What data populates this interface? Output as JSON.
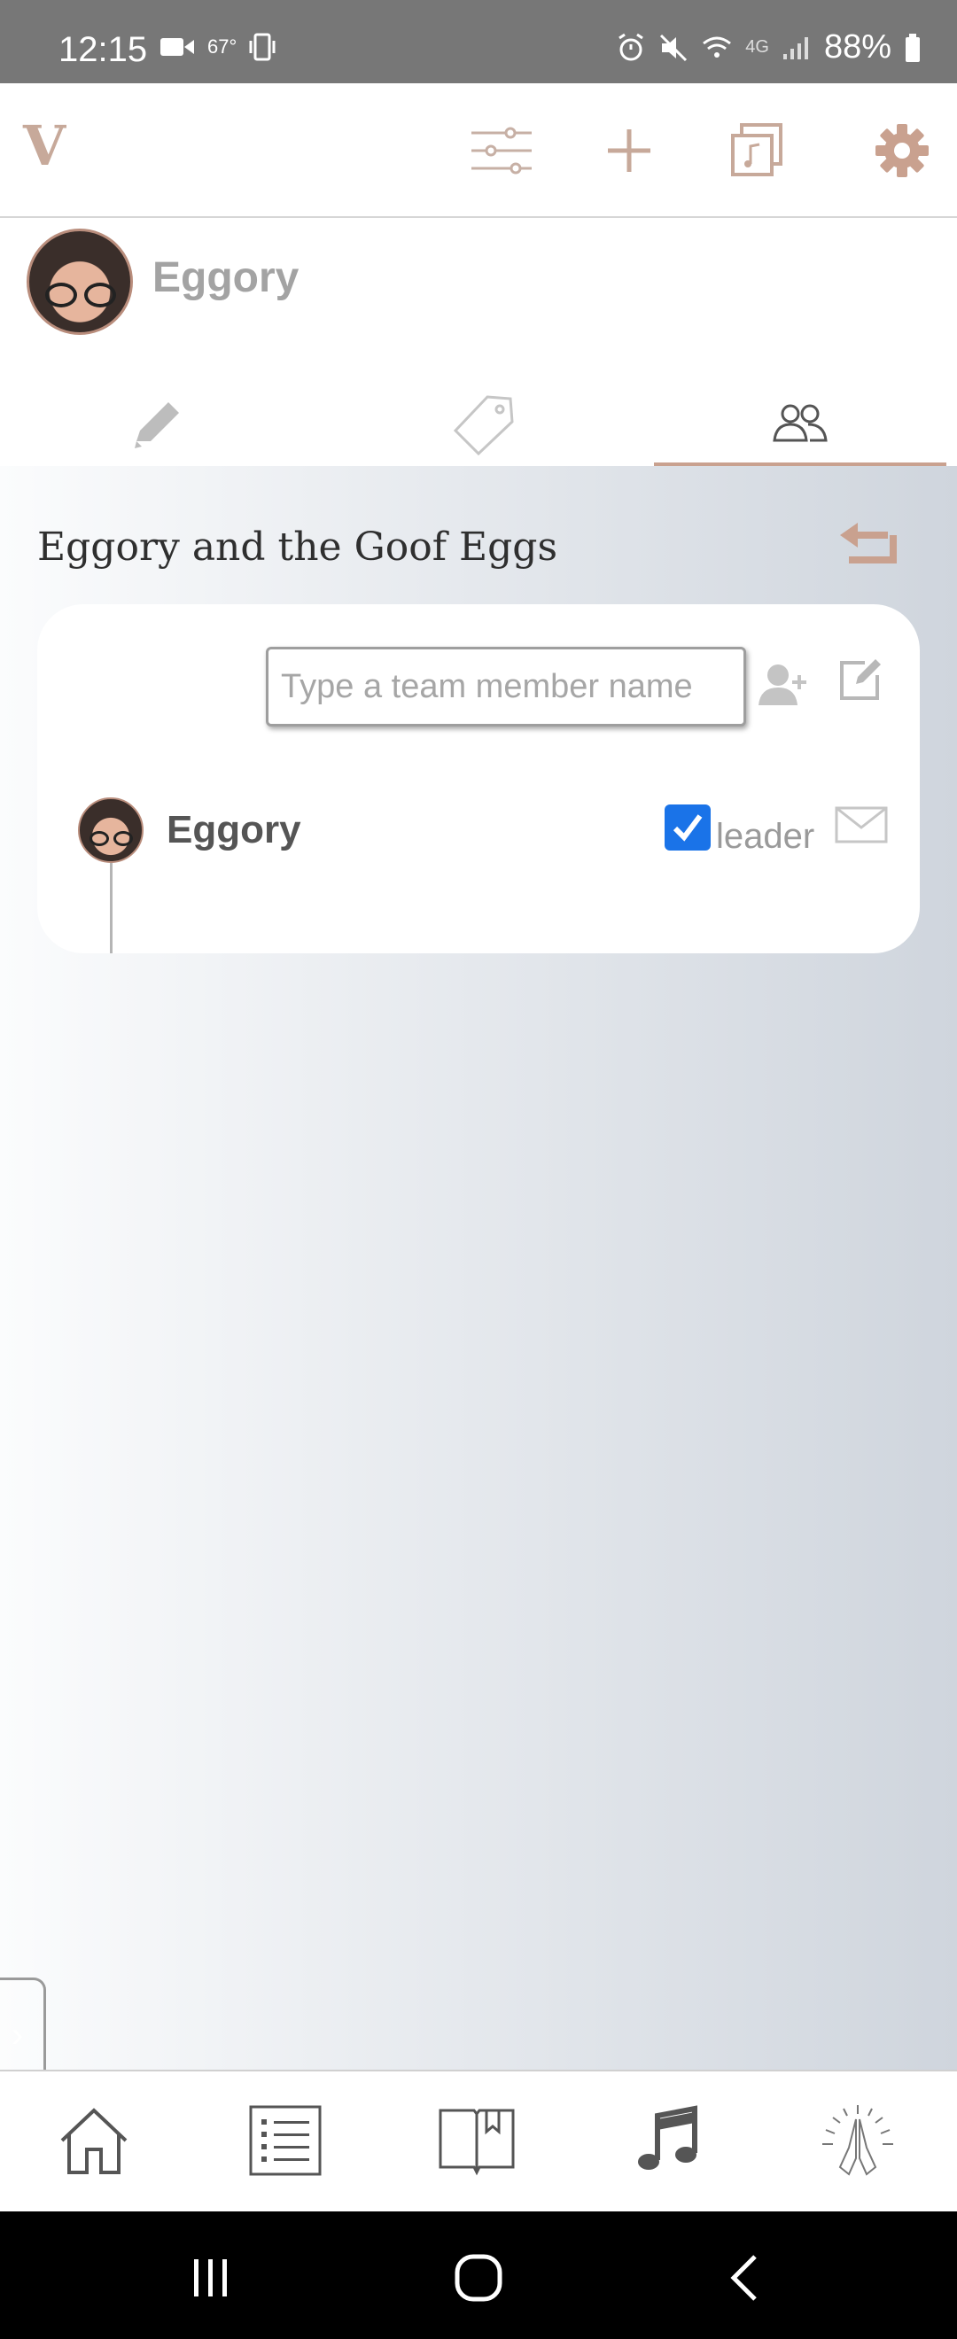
{
  "status_bar": {
    "time": "12:15",
    "temperature": "67°",
    "network": "4G",
    "battery": "88%"
  },
  "header": {
    "logo": "V",
    "icons": [
      "sliders-icon",
      "plus-icon",
      "music-library-icon",
      "gear-icon"
    ]
  },
  "profile": {
    "name": "Eggory"
  },
  "tabs": [
    {
      "name": "edit",
      "icon": "pencil-icon",
      "active": false
    },
    {
      "name": "tags",
      "icon": "tag-icon",
      "active": false
    },
    {
      "name": "team",
      "icon": "people-icon",
      "active": true
    }
  ],
  "team": {
    "title": "Eggory and the Goof Eggs",
    "input_placeholder": "Type a team member name",
    "input_value": "",
    "members": [
      {
        "name": "Eggory",
        "leader": true,
        "leader_label": "leader"
      }
    ]
  },
  "bottom_nav": [
    "home-icon",
    "list-icon",
    "book-icon",
    "music-note-icon",
    "praying-hands-icon"
  ],
  "colors": {
    "accent": "#c9a18f",
    "status_bar": "#777777",
    "checkbox": "#1a73e8"
  }
}
